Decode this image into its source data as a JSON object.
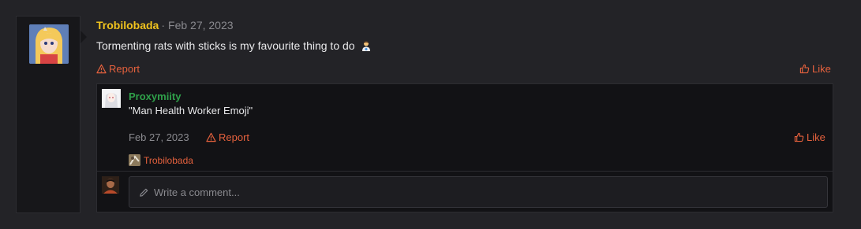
{
  "post": {
    "author": "Trobilobada",
    "separator": "·",
    "date": "Feb 27, 2023",
    "body": "Tormenting rats with sticks is my favourite thing to do",
    "report_label": "Report",
    "like_label": "Like"
  },
  "reply": {
    "author": "Proxymiity",
    "text": "\"Man Health Worker Emoji\"",
    "date": "Feb 27, 2023",
    "report_label": "Report",
    "like_label": "Like",
    "reaction_user": "Trobilobada"
  },
  "comment": {
    "placeholder": "Write a comment..."
  },
  "colors": {
    "author": "#f0c31e",
    "reply_author": "#2fa14a",
    "action": "#e5613d",
    "muted": "#8a8a8f"
  }
}
